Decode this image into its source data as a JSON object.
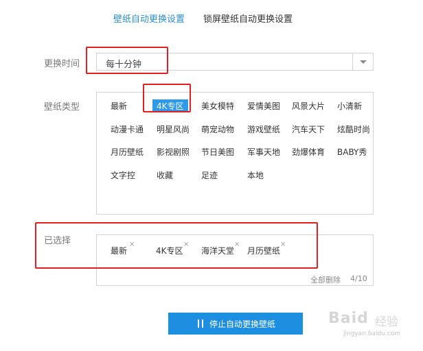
{
  "tabs": [
    {
      "label": "壁纸自动更换设置",
      "active": true
    },
    {
      "label": "锁屏壁纸自动更换设置",
      "active": false
    }
  ],
  "interval": {
    "label": "更换时间",
    "value": "每十分钟"
  },
  "wallpaper_type": {
    "label": "壁纸类型",
    "items": [
      [
        "最新",
        "4K专区",
        "美女模特",
        "爱情美图",
        "风景大片",
        "小清新"
      ],
      [
        "动漫卡通",
        "明星风尚",
        "萌宠动物",
        "游戏壁纸",
        "汽车天下",
        "炫酷时尚"
      ],
      [
        "月历壁纸",
        "影视剧照",
        "节日美图",
        "军事天地",
        "劲爆体育",
        "BABY秀"
      ],
      [
        "文字控",
        "收藏",
        "足迹",
        "本地"
      ]
    ],
    "selected": "4K专区"
  },
  "selected_section": {
    "label": "已选择",
    "chips": [
      "最新",
      "4K专区",
      "海洋天堂",
      "月历壁纸"
    ],
    "remove_symbol": "×",
    "clear_all": "全部删除",
    "count": "4/10"
  },
  "stop_button": {
    "label": "停止自动更换壁纸"
  },
  "watermark": {
    "brand": "Baid",
    "cn": "经验",
    "url": "jingyan.baidu.com"
  },
  "colors": {
    "accent": "#2a8fd8",
    "button": "#1e8ee0",
    "highlight": "#2e9bea",
    "annotation": "#e21e1e"
  }
}
